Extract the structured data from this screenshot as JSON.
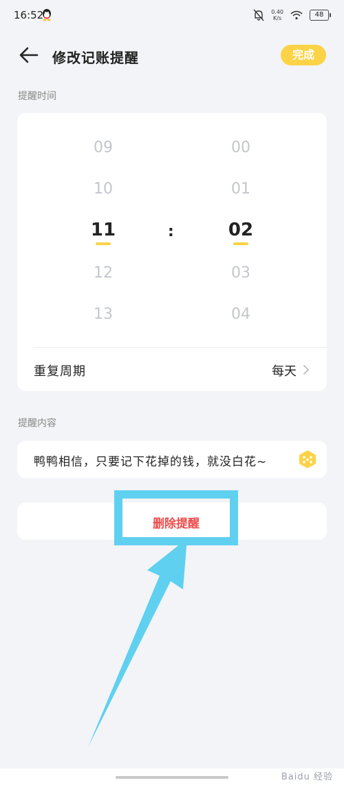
{
  "status_bar": {
    "time": "16:52",
    "net_speed_value": "0.40",
    "net_speed_unit": "K/s",
    "battery": "48"
  },
  "header": {
    "title": "修改记账提醒",
    "done_label": "完成"
  },
  "reminder_time": {
    "section_label": "提醒时间",
    "hours": [
      "09",
      "10",
      "11",
      "12",
      "13"
    ],
    "minutes": [
      "00",
      "01",
      "02",
      "03",
      "04"
    ],
    "selected_hour": "11",
    "selected_minute": "02",
    "separator": ":",
    "repeat_label": "重复周期",
    "repeat_value": "每天"
  },
  "reminder_content": {
    "section_label": "提醒内容",
    "text": "鸭鸭相信，只要记下花掉的钱，就没白花~"
  },
  "delete_label": "删除提醒",
  "watermark": "Baidu 经验",
  "colors": {
    "accent": "#fcd347",
    "delete": "#ec4c4c",
    "annotation": "#5fd0f0",
    "background": "#f3f4f7"
  }
}
